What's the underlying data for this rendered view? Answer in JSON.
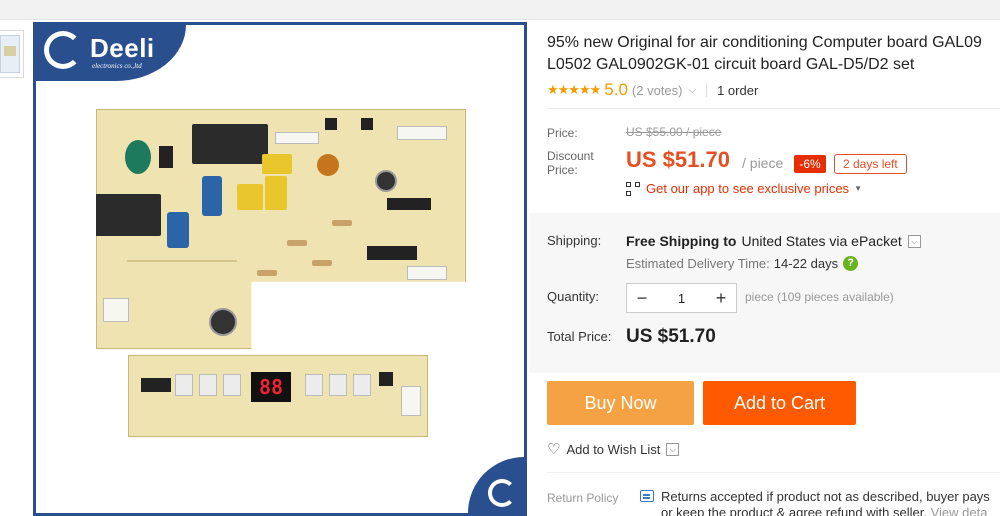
{
  "product": {
    "title_line1": "95% new Original for air conditioning Computer board GAL09",
    "title_line2": "L0502 GAL0902GK-01 circuit board GAL-D5/D2 set",
    "rating_stars": "★★★★★",
    "rating_score": "5.0",
    "votes": "(2 votes)",
    "orders": "1 order"
  },
  "image": {
    "brand_name": "Deeli",
    "brand_sub": "electronics co.,ltd",
    "display_digits": "88",
    "colors": {
      "frame": "#2a4f8f",
      "pcb": "#efe3b2"
    }
  },
  "price": {
    "label": "Price:",
    "original": "US $55.00 / piece",
    "discount_label": "Discount Price:",
    "current": "US $51.70",
    "unit": "/ piece",
    "discount_badge": "-6%",
    "days_left": "2 days left",
    "app_promo": "Get our app to see exclusive prices",
    "colors": {
      "price": "#e64f22",
      "badge": "#e62e04"
    }
  },
  "shipping": {
    "label": "Shipping:",
    "free": "Free Shipping to",
    "country": "United States via ePacket",
    "delivery_label": "Estimated Delivery Time:",
    "delivery_days": "14-22 days"
  },
  "quantity": {
    "label": "Quantity:",
    "minus": "−",
    "value": "1",
    "plus": "+",
    "available": "piece (109 pieces available)"
  },
  "total": {
    "label": "Total Price:",
    "value": "US $51.70"
  },
  "actions": {
    "buy_now": "Buy Now",
    "add_to_cart": "Add to Cart",
    "wish_list": "Add to Wish List",
    "colors": {
      "buy": "#f5a244",
      "cart": "#ff5a00"
    }
  },
  "return_policy": {
    "label": "Return Policy",
    "line1": "Returns accepted if product not as described, buyer pays",
    "line2": "or keep the product & agree refund with seller.",
    "link": "View deta"
  }
}
